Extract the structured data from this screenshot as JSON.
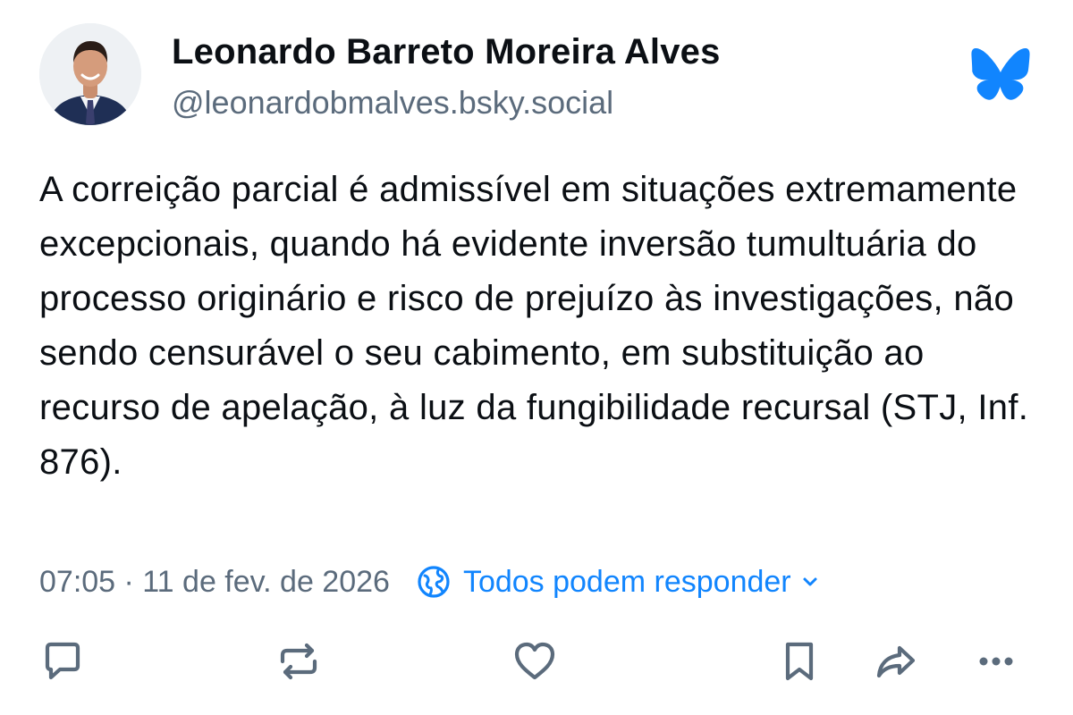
{
  "author": {
    "display_name": "Leonardo Barreto Moreira Alves",
    "handle": "@leonardobmalves.bsky.social",
    "avatar_icon": "profile-photo"
  },
  "brand": {
    "logo_icon": "bluesky-butterfly-icon",
    "color": "#1185fe"
  },
  "post": {
    "text": "A correição parcial é admissível em situações extremamente excepcionais, quando há evidente inversão tumultuária do processo originário e risco de prejuízo às investigações, não sendo censurável o seu cabimento, em substituição ao recurso de apelação, à luz da fungibilidade recursal (STJ, Inf. 876).",
    "timestamp": "07:05 · 11 de fev. de 2026",
    "reply_setting": "Todos podem responder",
    "reply_setting_icon": "globe-icon"
  },
  "actions": [
    {
      "name": "reply",
      "icon": "speech-bubble-icon"
    },
    {
      "name": "repost",
      "icon": "repost-arrows-icon"
    },
    {
      "name": "like",
      "icon": "heart-icon"
    },
    {
      "name": "bookmark",
      "icon": "bookmark-icon"
    },
    {
      "name": "share",
      "icon": "share-arrow-icon"
    },
    {
      "name": "more",
      "icon": "ellipsis-icon"
    }
  ],
  "colors": {
    "text_primary": "#0b0f14",
    "text_secondary": "#5b6b7c",
    "accent": "#1185fe",
    "icon": "#5b6b7c"
  }
}
